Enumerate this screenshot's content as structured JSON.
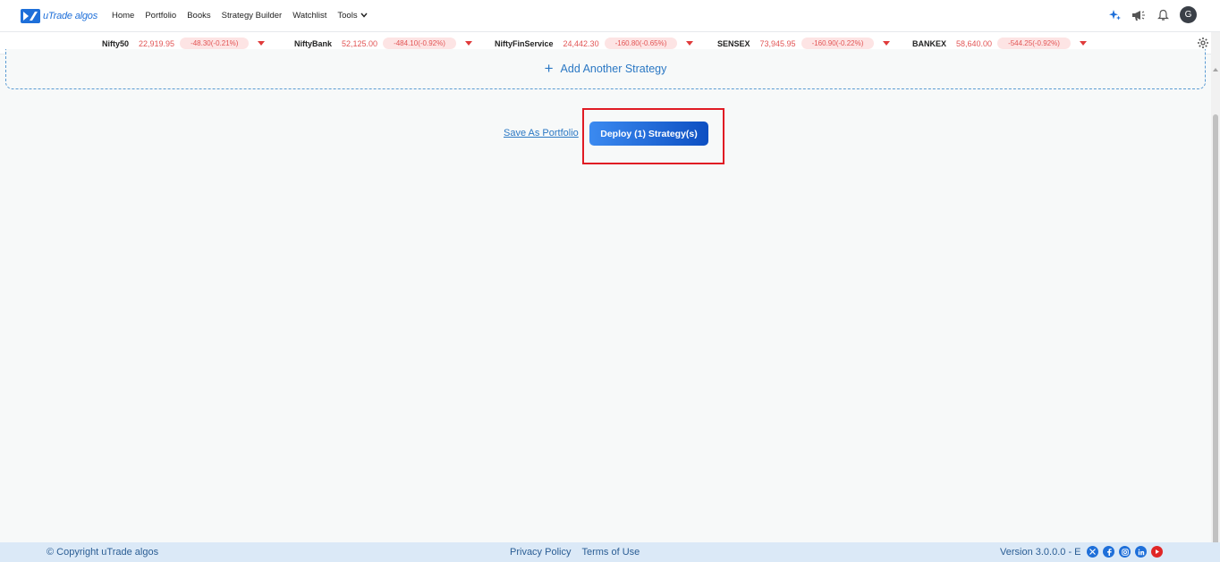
{
  "brand": {
    "name": "uTrade algos"
  },
  "nav": {
    "links": [
      "Home",
      "Portfolio",
      "Books",
      "Strategy Builder",
      "Watchlist",
      "Tools"
    ]
  },
  "user": {
    "avatar_initial": "G"
  },
  "ticker": [
    {
      "name": "Nifty50",
      "price": "22,919.95",
      "change": "-48.30(-0.21%)"
    },
    {
      "name": "NiftyBank",
      "price": "52,125.00",
      "change": "-484.10(-0.92%)"
    },
    {
      "name": "NiftyFinService",
      "price": "24,442.30",
      "change": "-160.80(-0.65%)"
    },
    {
      "name": "SENSEX",
      "price": "73,945.95",
      "change": "-160.90(-0.22%)"
    },
    {
      "name": "BANKEX",
      "price": "58,640.00",
      "change": "-544.25(-0.92%)"
    }
  ],
  "strategy": {
    "add_label": "Add Another Strategy",
    "save_label": "Save As Portfolio",
    "deploy_label": "Deploy (1) Strategy(s)"
  },
  "footer": {
    "copyright": "© Copyright uTrade algos",
    "privacy": "Privacy Policy",
    "terms": "Terms of Use",
    "version": "Version 3.0.0.0 - E"
  },
  "colors": {
    "brand": "#1e6fd9",
    "negative": "#e25555",
    "highlight": "#e01b24",
    "footer_bg": "#dbe9f7"
  }
}
